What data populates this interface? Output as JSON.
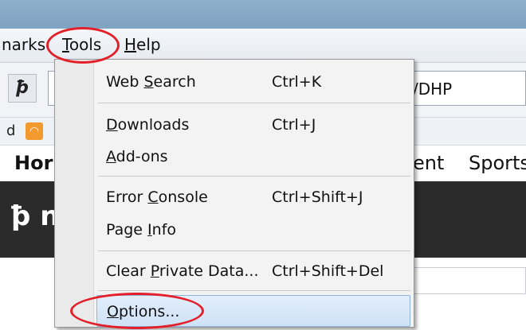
{
  "menubar": {
    "bookmarks_partial": "narks",
    "tools_mnemonic": "T",
    "tools_rest": "ools",
    "help_mnemonic": "H",
    "help_rest": "elp"
  },
  "toolbar": {
    "url_partial": "/DHP"
  },
  "bookmarks_bar": {
    "partial": "d"
  },
  "page": {
    "nav_partial_left": "Hor",
    "nav_partial_mid": "ent",
    "nav_sports": "Sports",
    "logo_partial": "n"
  },
  "tools_menu": {
    "items": [
      {
        "pre": "Web ",
        "mnemonic": "S",
        "post": "earch",
        "shortcut": "Ctrl+K"
      },
      {
        "pre": "",
        "mnemonic": "D",
        "post": "ownloads",
        "shortcut": "Ctrl+J"
      },
      {
        "pre": "",
        "mnemonic": "A",
        "post": "dd-ons",
        "shortcut": ""
      },
      {
        "pre": "Error ",
        "mnemonic": "C",
        "post": "onsole",
        "shortcut": "Ctrl+Shift+J"
      },
      {
        "pre": "Page ",
        "mnemonic": "I",
        "post": "nfo",
        "shortcut": ""
      },
      {
        "pre": "Clear ",
        "mnemonic": "P",
        "post": "rivate Data...",
        "shortcut": "Ctrl+Shift+Del"
      },
      {
        "pre": "",
        "mnemonic": "O",
        "post": "ptions...",
        "shortcut": ""
      }
    ]
  },
  "colors": {
    "annotation_circle": "#e3202a",
    "highlight": "#cfe2f7"
  }
}
